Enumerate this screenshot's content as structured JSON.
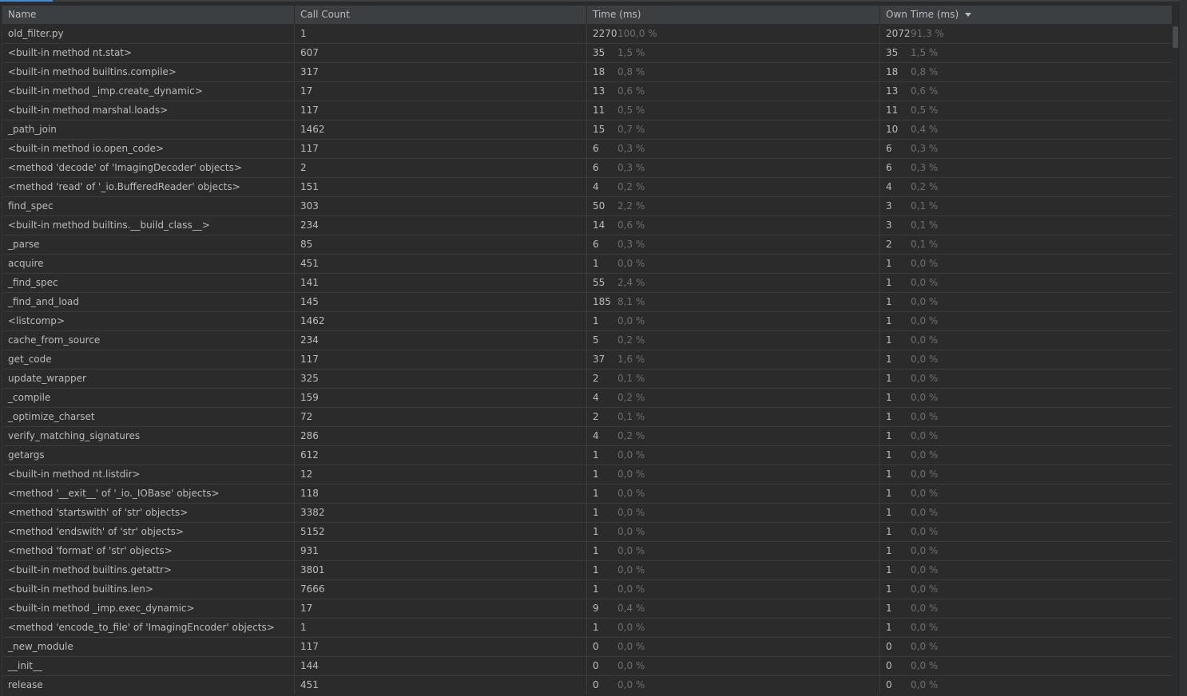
{
  "columns": {
    "name": "Name",
    "call_count": "Call Count",
    "time": "Time (ms)",
    "own_time": "Own Time (ms)"
  },
  "sort": {
    "column": "own_time",
    "direction": "descending"
  },
  "rows": [
    {
      "name": "old_filter.py",
      "calls": "1",
      "time": "2270",
      "time_pct": "100,0 %",
      "own": "2072",
      "own_pct": "91,3 %"
    },
    {
      "name": "<built-in method nt.stat>",
      "calls": "607",
      "time": "35",
      "time_pct": "1,5 %",
      "own": "35",
      "own_pct": "1,5 %"
    },
    {
      "name": "<built-in method builtins.compile>",
      "calls": "317",
      "time": "18",
      "time_pct": "0,8 %",
      "own": "18",
      "own_pct": "0,8 %"
    },
    {
      "name": "<built-in method _imp.create_dynamic>",
      "calls": "17",
      "time": "13",
      "time_pct": "0,6 %",
      "own": "13",
      "own_pct": "0,6 %"
    },
    {
      "name": "<built-in method marshal.loads>",
      "calls": "117",
      "time": "11",
      "time_pct": "0,5 %",
      "own": "11",
      "own_pct": "0,5 %"
    },
    {
      "name": "_path_join",
      "calls": "1462",
      "time": "15",
      "time_pct": "0,7 %",
      "own": "10",
      "own_pct": "0,4 %"
    },
    {
      "name": "<built-in method io.open_code>",
      "calls": "117",
      "time": "6",
      "time_pct": "0,3 %",
      "own": "6",
      "own_pct": "0,3 %"
    },
    {
      "name": "<method 'decode' of 'ImagingDecoder' objects>",
      "calls": "2",
      "time": "6",
      "time_pct": "0,3 %",
      "own": "6",
      "own_pct": "0,3 %"
    },
    {
      "name": "<method 'read' of '_io.BufferedReader' objects>",
      "calls": "151",
      "time": "4",
      "time_pct": "0,2 %",
      "own": "4",
      "own_pct": "0,2 %"
    },
    {
      "name": "find_spec",
      "calls": "303",
      "time": "50",
      "time_pct": "2,2 %",
      "own": "3",
      "own_pct": "0,1 %"
    },
    {
      "name": "<built-in method builtins.__build_class__>",
      "calls": "234",
      "time": "14",
      "time_pct": "0,6 %",
      "own": "3",
      "own_pct": "0,1 %"
    },
    {
      "name": "_parse",
      "calls": "85",
      "time": "6",
      "time_pct": "0,3 %",
      "own": "2",
      "own_pct": "0,1 %"
    },
    {
      "name": "acquire",
      "calls": "451",
      "time": "1",
      "time_pct": "0,0 %",
      "own": "1",
      "own_pct": "0,0 %"
    },
    {
      "name": "_find_spec",
      "calls": "141",
      "time": "55",
      "time_pct": "2,4 %",
      "own": "1",
      "own_pct": "0,0 %"
    },
    {
      "name": "_find_and_load",
      "calls": "145",
      "time": "185",
      "time_pct": "8,1 %",
      "own": "1",
      "own_pct": "0,0 %"
    },
    {
      "name": "<listcomp>",
      "calls": "1462",
      "time": "1",
      "time_pct": "0,0 %",
      "own": "1",
      "own_pct": "0,0 %"
    },
    {
      "name": "cache_from_source",
      "calls": "234",
      "time": "5",
      "time_pct": "0,2 %",
      "own": "1",
      "own_pct": "0,0 %"
    },
    {
      "name": "get_code",
      "calls": "117",
      "time": "37",
      "time_pct": "1,6 %",
      "own": "1",
      "own_pct": "0,0 %"
    },
    {
      "name": "update_wrapper",
      "calls": "325",
      "time": "2",
      "time_pct": "0,1 %",
      "own": "1",
      "own_pct": "0,0 %"
    },
    {
      "name": "_compile",
      "calls": "159",
      "time": "4",
      "time_pct": "0,2 %",
      "own": "1",
      "own_pct": "0,0 %"
    },
    {
      "name": "_optimize_charset",
      "calls": "72",
      "time": "2",
      "time_pct": "0,1 %",
      "own": "1",
      "own_pct": "0,0 %"
    },
    {
      "name": "verify_matching_signatures",
      "calls": "286",
      "time": "4",
      "time_pct": "0,2 %",
      "own": "1",
      "own_pct": "0,0 %"
    },
    {
      "name": "getargs",
      "calls": "612",
      "time": "1",
      "time_pct": "0,0 %",
      "own": "1",
      "own_pct": "0,0 %"
    },
    {
      "name": "<built-in method nt.listdir>",
      "calls": "12",
      "time": "1",
      "time_pct": "0,0 %",
      "own": "1",
      "own_pct": "0,0 %"
    },
    {
      "name": "<method '__exit__' of '_io._IOBase' objects>",
      "calls": "118",
      "time": "1",
      "time_pct": "0,0 %",
      "own": "1",
      "own_pct": "0,0 %"
    },
    {
      "name": "<method 'startswith' of 'str' objects>",
      "calls": "3382",
      "time": "1",
      "time_pct": "0,0 %",
      "own": "1",
      "own_pct": "0,0 %"
    },
    {
      "name": "<method 'endswith' of 'str' objects>",
      "calls": "5152",
      "time": "1",
      "time_pct": "0,0 %",
      "own": "1",
      "own_pct": "0,0 %"
    },
    {
      "name": "<method 'format' of 'str' objects>",
      "calls": "931",
      "time": "1",
      "time_pct": "0,0 %",
      "own": "1",
      "own_pct": "0,0 %"
    },
    {
      "name": "<built-in method builtins.getattr>",
      "calls": "3801",
      "time": "1",
      "time_pct": "0,0 %",
      "own": "1",
      "own_pct": "0,0 %"
    },
    {
      "name": "<built-in method builtins.len>",
      "calls": "7666",
      "time": "1",
      "time_pct": "0,0 %",
      "own": "1",
      "own_pct": "0,0 %"
    },
    {
      "name": "<built-in method _imp.exec_dynamic>",
      "calls": "17",
      "time": "9",
      "time_pct": "0,4 %",
      "own": "1",
      "own_pct": "0,0 %"
    },
    {
      "name": "<method 'encode_to_file' of 'ImagingEncoder' objects>",
      "calls": "1",
      "time": "1",
      "time_pct": "0,0 %",
      "own": "1",
      "own_pct": "0,0 %"
    },
    {
      "name": "_new_module",
      "calls": "117",
      "time": "0",
      "time_pct": "0,0 %",
      "own": "0",
      "own_pct": "0,0 %"
    },
    {
      "name": "__init__",
      "calls": "144",
      "time": "0",
      "time_pct": "0,0 %",
      "own": "0",
      "own_pct": "0,0 %"
    },
    {
      "name": "release",
      "calls": "451",
      "time": "0",
      "time_pct": "0,0 %",
      "own": "0",
      "own_pct": "0,0 %"
    }
  ]
}
